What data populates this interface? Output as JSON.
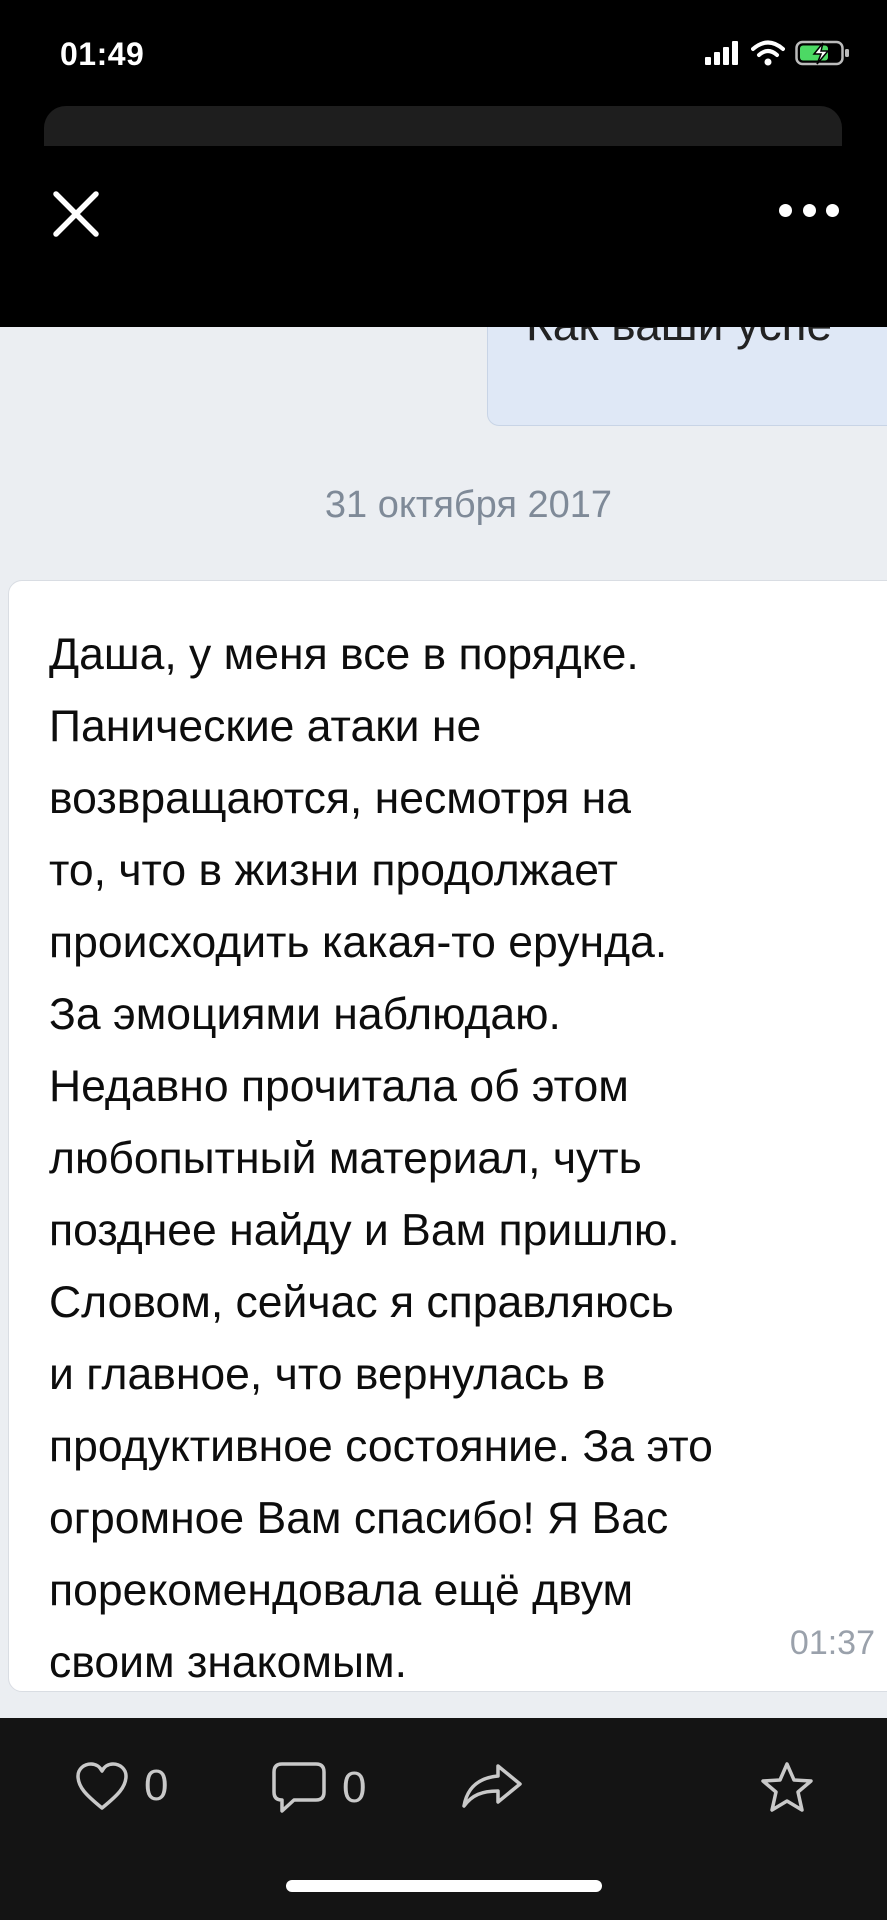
{
  "status_bar": {
    "time": "01:49",
    "icons": [
      "signal-icon",
      "wifi-icon",
      "battery-charging-icon"
    ]
  },
  "header": {
    "close_icon": "close-icon",
    "more_icon": "more-icon"
  },
  "previous_message": {
    "partial_text": "Как ваши успе"
  },
  "date_separator": "31 октября 2017",
  "message": {
    "lines": [
      "Даша, у меня все в порядке.",
      "Панические атаки не",
      "возвращаются, несмотря на",
      "то, что в жизни продолжает",
      "происходить какая-то ерунда.",
      "За эмоциями наблюдаю.",
      "Недавно прочитала об этом",
      "любопытный материал, чуть",
      "позднее найду и Вам пришлю.",
      "Словом, сейчас я справляюсь",
      "и главное, что вернулась в",
      "продуктивное состояние. За это",
      "огромное Вам спасибо! Я Вас",
      "порекомендовала ещё двум",
      "своим знакомым."
    ],
    "time": "01:37"
  },
  "actions": {
    "likes": "0",
    "comments": "0",
    "like_icon": "heart-icon",
    "comment_icon": "comment-icon",
    "share_icon": "share-icon",
    "favorite_icon": "star-icon"
  },
  "colors": {
    "background": "#ebeef2",
    "bubble_outgoing": "#dfe8f6",
    "bubble_incoming": "#ffffff",
    "chrome": "#000000"
  }
}
